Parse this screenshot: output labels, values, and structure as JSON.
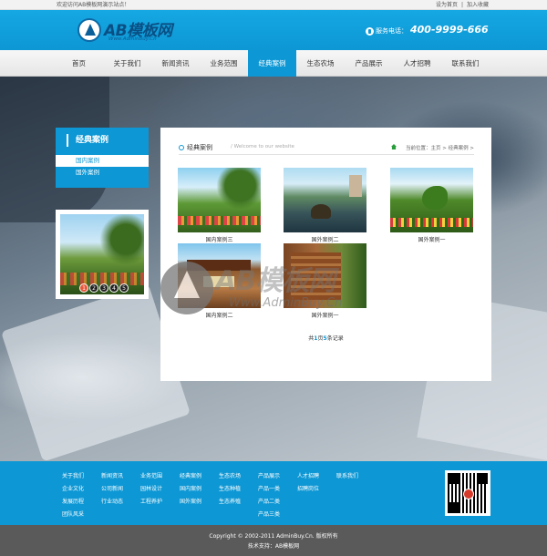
{
  "topbar": {
    "welcome": "欢迎访问AB模板网演示站点！",
    "set_home": "设为首页",
    "divider": "|",
    "add_favorite": "加入收藏"
  },
  "header": {
    "logo_text": "AB模板网",
    "logo_sub": "Www.AdminBuy.Cn",
    "phone_label": "服务电话：",
    "phone_number": "400-9999-666"
  },
  "nav": {
    "items": [
      "首页",
      "关于我们",
      "新闻资讯",
      "业务范围",
      "经典案例",
      "生态农场",
      "产品展示",
      "人才招聘",
      "联系我们"
    ],
    "active_index": 4
  },
  "sidebar": {
    "title": "经典案例",
    "items": [
      "国内案例",
      "国外案例"
    ],
    "slider_numbers": [
      "1",
      "2",
      "3",
      "4",
      "5"
    ]
  },
  "content": {
    "title": "经典案例",
    "subtitle": "/ Welcome to our website",
    "breadcrumb": "当前位置：主页 > 经典案例 >",
    "cases": [
      "国内案例三",
      "国外案例二",
      "国外案例一",
      "国内案例二",
      "国外案例一"
    ],
    "pager_prefix": "共",
    "pager_pages": "1",
    "pager_mid": "页",
    "pager_count": "5",
    "pager_suffix": "条记录"
  },
  "watermark": {
    "text": "AB模板网",
    "url": "Www.AdminBuy.Cn"
  },
  "footer": {
    "columns": [
      [
        "关于我们",
        "企业文化",
        "发展历程",
        "团队风采"
      ],
      [
        "新闻资讯",
        "公司新闻",
        "行业动态"
      ],
      [
        "业务范围",
        "园林设计",
        "工程养护"
      ],
      [
        "经典案例",
        "国内案例",
        "国外案例"
      ],
      [
        "生态农场",
        "生态种植",
        "生态养殖"
      ],
      [
        "产品展示",
        "产品一类",
        "产品二类",
        "产品三类"
      ],
      [
        "人才招聘",
        "招聘岗位"
      ],
      [
        "联系我们"
      ]
    ],
    "copyright": "Copyright © 2002-2011 AdminBuy.Cn. 版权所有",
    "support": "技术支持：AB模板网"
  },
  "colors": {
    "brand_blue": "#0d97d4",
    "footer_gray": "#5a5a5a"
  }
}
